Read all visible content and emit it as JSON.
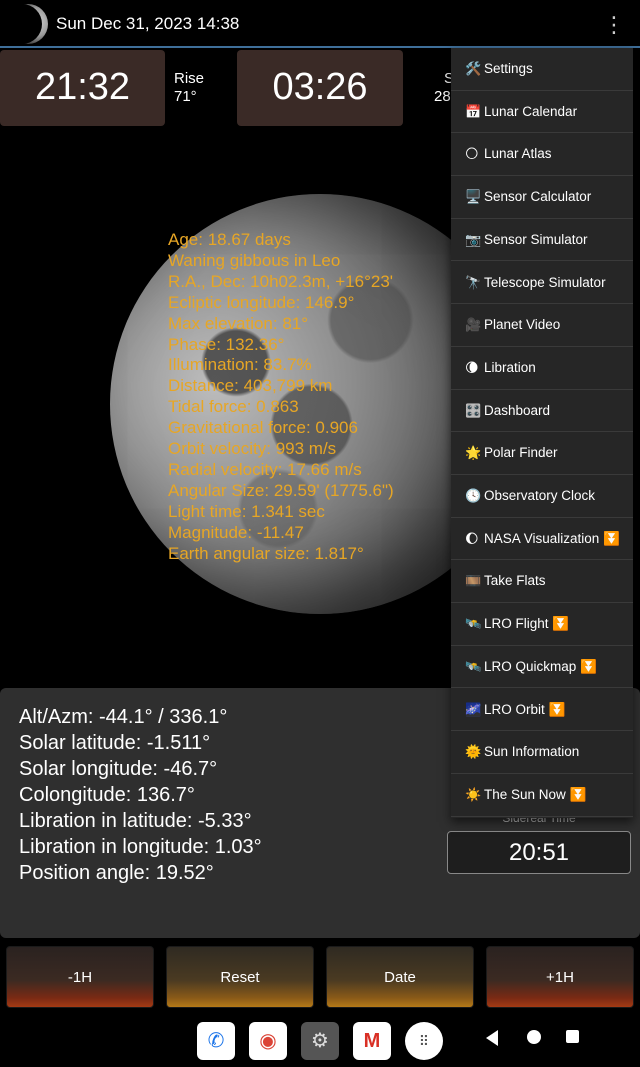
{
  "header": {
    "datetime": "Sun Dec 31, 2023 14:38",
    "menu_icon": "kebab-menu-icon"
  },
  "time_panels": {
    "moonrise_time": "21:32",
    "rise_label": "Rise",
    "rise_azimuth": "71°",
    "moonset_time": "03:26",
    "set_label_partial": "S",
    "set_azimuth_partial": "28"
  },
  "moon_info": [
    "Age: 18.67 days",
    "Waning gibbous in Leo",
    "R.A., Dec: 10h02.3m, +16°23'",
    "Ecliptic longitude: 146.9°",
    "Max elevation: 81°",
    "Phase: 132.36°",
    "Illumination: 83.7%",
    "Distance: 403,799 km",
    "Tidal force: 0.863",
    "Gravitational force: 0.906",
    "Orbit velocity: 993 m/s",
    "Radial velocity: 17.66 m/s",
    "Angular Size: 29.59' (1775.6\")",
    "Light time: 1.341 sec",
    "Magnitude: -11.47",
    "Earth angular size: 1.817°"
  ],
  "bottom_info": [
    "Alt/Azm: -44.1° / 336.1°",
    "Solar latitude: -1.511°",
    "Solar longitude: -46.7°",
    "Colongitude: 136.7°",
    "Libration in latitude: -5.33°",
    "Libration in longitude: 1.03°",
    "Position angle: 19.52°"
  ],
  "sidereal": {
    "label": "Sidereal Time",
    "value": "20:51"
  },
  "buttons": {
    "minus_hour": "-1H",
    "reset": "Reset",
    "date": "Date",
    "plus_hour": "+1H"
  },
  "menu": [
    {
      "icon": "🛠️",
      "label": "Settings"
    },
    {
      "icon": "📅",
      "label": "Lunar Calendar"
    },
    {
      "icon": "🌕",
      "label": "Lunar Atlas"
    },
    {
      "icon": "🖥️",
      "label": "Sensor Calculator"
    },
    {
      "icon": "📷",
      "label": "Sensor Simulator"
    },
    {
      "icon": "🔭",
      "label": "Telescope Simulator"
    },
    {
      "icon": "🎥",
      "label": "Planet Video"
    },
    {
      "icon": "🌘",
      "label": "Libration"
    },
    {
      "icon": "🎛️",
      "label": "Dashboard"
    },
    {
      "icon": "🌟",
      "label": "Polar Finder"
    },
    {
      "icon": "🕓",
      "label": "Observatory Clock"
    },
    {
      "icon": "🌔",
      "label": "NASA Visualization ⏬"
    },
    {
      "icon": "🎞️",
      "label": "Take Flats"
    },
    {
      "icon": "🛰️",
      "label": "LRO Flight ⏬"
    },
    {
      "icon": "🛰️",
      "label": "LRO Quickmap ⏬"
    },
    {
      "icon": "🌌",
      "label": "LRO Orbit ⏬"
    },
    {
      "icon": "🌞",
      "label": "Sun Information"
    },
    {
      "icon": "☀️",
      "label": "The Sun Now ⏬"
    }
  ]
}
